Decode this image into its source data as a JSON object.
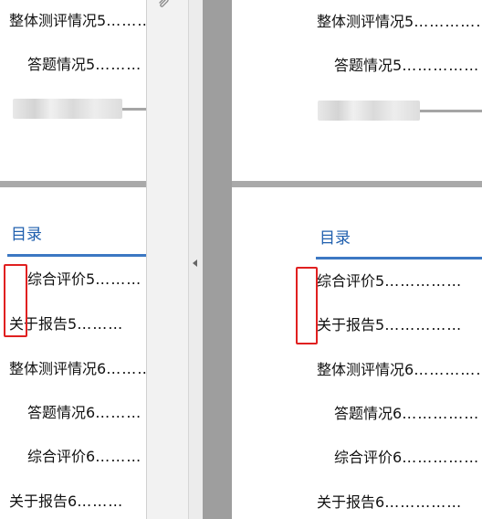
{
  "left": {
    "top_items": [
      {
        "label": "整体测评情况5",
        "dots": "………"
      },
      {
        "label": "答题情况5",
        "dots": "………"
      }
    ],
    "heading": "目录",
    "items": [
      {
        "label": "综合评价5",
        "dots": "………"
      },
      {
        "label": "关于报告5",
        "dots": "………"
      },
      {
        "label": "整体测评情况6",
        "dots": "………"
      },
      {
        "label": "答题情况6",
        "dots": "………"
      },
      {
        "label": "综合评价6",
        "dots": "………"
      },
      {
        "label": "关于报告6",
        "dots": "………"
      }
    ]
  },
  "right": {
    "top_items": [
      {
        "label": "整体测评情况5",
        "dots": "……………"
      },
      {
        "label": "答题情况5",
        "dots": "……………"
      }
    ],
    "heading": "目录",
    "items": [
      {
        "label": "综合评价5",
        "dots": "……………"
      },
      {
        "label": "关于报告5",
        "dots": "……………"
      },
      {
        "label": "整体测评情况6",
        "dots": "……………"
      },
      {
        "label": "答题情况6",
        "dots": "……………"
      },
      {
        "label": "综合评价6",
        "dots": "……………"
      },
      {
        "label": "关于报告6",
        "dots": "……………"
      }
    ]
  },
  "icons": {
    "attachment": "paperclip-icon",
    "collapse": "chevron-left-icon"
  },
  "colors": {
    "heading": "#1f5fae",
    "highlight": "#e02020",
    "divider": "#a9a9a9"
  }
}
